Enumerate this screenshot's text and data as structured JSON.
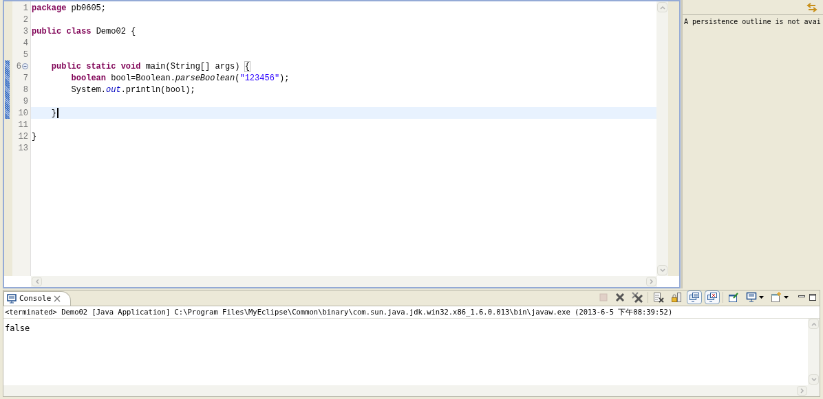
{
  "editor": {
    "lines": [
      {
        "number": "1",
        "tokens": [
          {
            "kind": "keyword",
            "text": "package "
          },
          {
            "kind": "plain",
            "text": "pb0605;"
          }
        ],
        "current": false,
        "fold": false,
        "marked": false
      },
      {
        "number": "2",
        "current": false,
        "fold": false,
        "marked": false
      },
      {
        "number": "3",
        "tokens": [
          {
            "kind": "keyword",
            "text": "public "
          },
          {
            "kind": "keyword",
            "text": "class "
          },
          {
            "kind": "plain",
            "text": "Demo02 {"
          }
        ],
        "current": false,
        "fold": false,
        "marked": false
      },
      {
        "number": "4",
        "current": false,
        "fold": false,
        "marked": false
      },
      {
        "number": "5",
        "current": false,
        "fold": false,
        "marked": false
      },
      {
        "number": "6",
        "tokens": [
          {
            "kind": "keyword",
            "text": "    public "
          },
          {
            "kind": "keyword",
            "text": "static "
          },
          {
            "kind": "keyword",
            "text": "void "
          },
          {
            "kind": "plain",
            "text": "main(String[] args) "
          },
          {
            "kind": "bracket",
            "text": "{"
          }
        ],
        "current": false,
        "fold": true,
        "marked": true
      },
      {
        "number": "7",
        "tokens": [
          {
            "kind": "keyword",
            "text": "        boolean "
          },
          {
            "kind": "plain",
            "text": "bool=Boolean."
          },
          {
            "kind": "static-method",
            "text": "parseBoolean"
          },
          {
            "kind": "plain",
            "text": "("
          },
          {
            "kind": "string",
            "text": "\"123456\""
          },
          {
            "kind": "plain",
            "text": ");"
          }
        ],
        "current": false,
        "fold": false,
        "marked": true
      },
      {
        "number": "8",
        "tokens": [
          {
            "kind": "plain",
            "text": "        System."
          },
          {
            "kind": "field",
            "text": "out"
          },
          {
            "kind": "plain",
            "text": ".println(bool);"
          }
        ],
        "current": false,
        "fold": false,
        "marked": true
      },
      {
        "number": "9",
        "current": false,
        "fold": false,
        "marked": true
      },
      {
        "number": "10",
        "tokens": [
          {
            "kind": "plain",
            "text": "    }"
          }
        ],
        "current": true,
        "fold": false,
        "marked": true
      },
      {
        "number": "11",
        "current": false,
        "fold": false,
        "marked": false
      },
      {
        "number": "12",
        "tokens": [
          {
            "kind": "plain",
            "text": "}"
          }
        ],
        "current": false,
        "fold": false,
        "marked": false
      },
      {
        "number": "13",
        "current": false,
        "fold": false,
        "marked": false
      }
    ]
  },
  "outline": {
    "message": "A persistence outline is not avai"
  },
  "console": {
    "tab": {
      "label": "Console",
      "selected": true
    },
    "toolbar": [
      {
        "kind": "terminate",
        "disabled": true,
        "selected": false
      },
      {
        "kind": "remove",
        "disabled": false,
        "selected": false
      },
      {
        "kind": "remove-all",
        "disabled": false,
        "selected": false
      },
      {
        "kind": "clear",
        "disabled": false,
        "selected": false
      },
      {
        "kind": "scroll-lock",
        "disabled": false,
        "selected": false
      },
      {
        "kind": "show-out",
        "disabled": false,
        "selected": true
      },
      {
        "kind": "show-err",
        "disabled": false,
        "selected": true
      },
      {
        "kind": "pin",
        "disabled": false,
        "selected": false
      },
      {
        "kind": "display",
        "disabled": false,
        "selected": false
      },
      {
        "kind": "open-console",
        "disabled": false,
        "selected": false
      }
    ],
    "status": "<terminated> Demo02 [Java Application] C:\\Program Files\\MyEclipse\\Common\\binary\\com.sun.java.jdk.win32.x86_1.6.0.013\\bin\\javaw.exe (2013-6-5 下午08:39:52)",
    "output": "false"
  }
}
